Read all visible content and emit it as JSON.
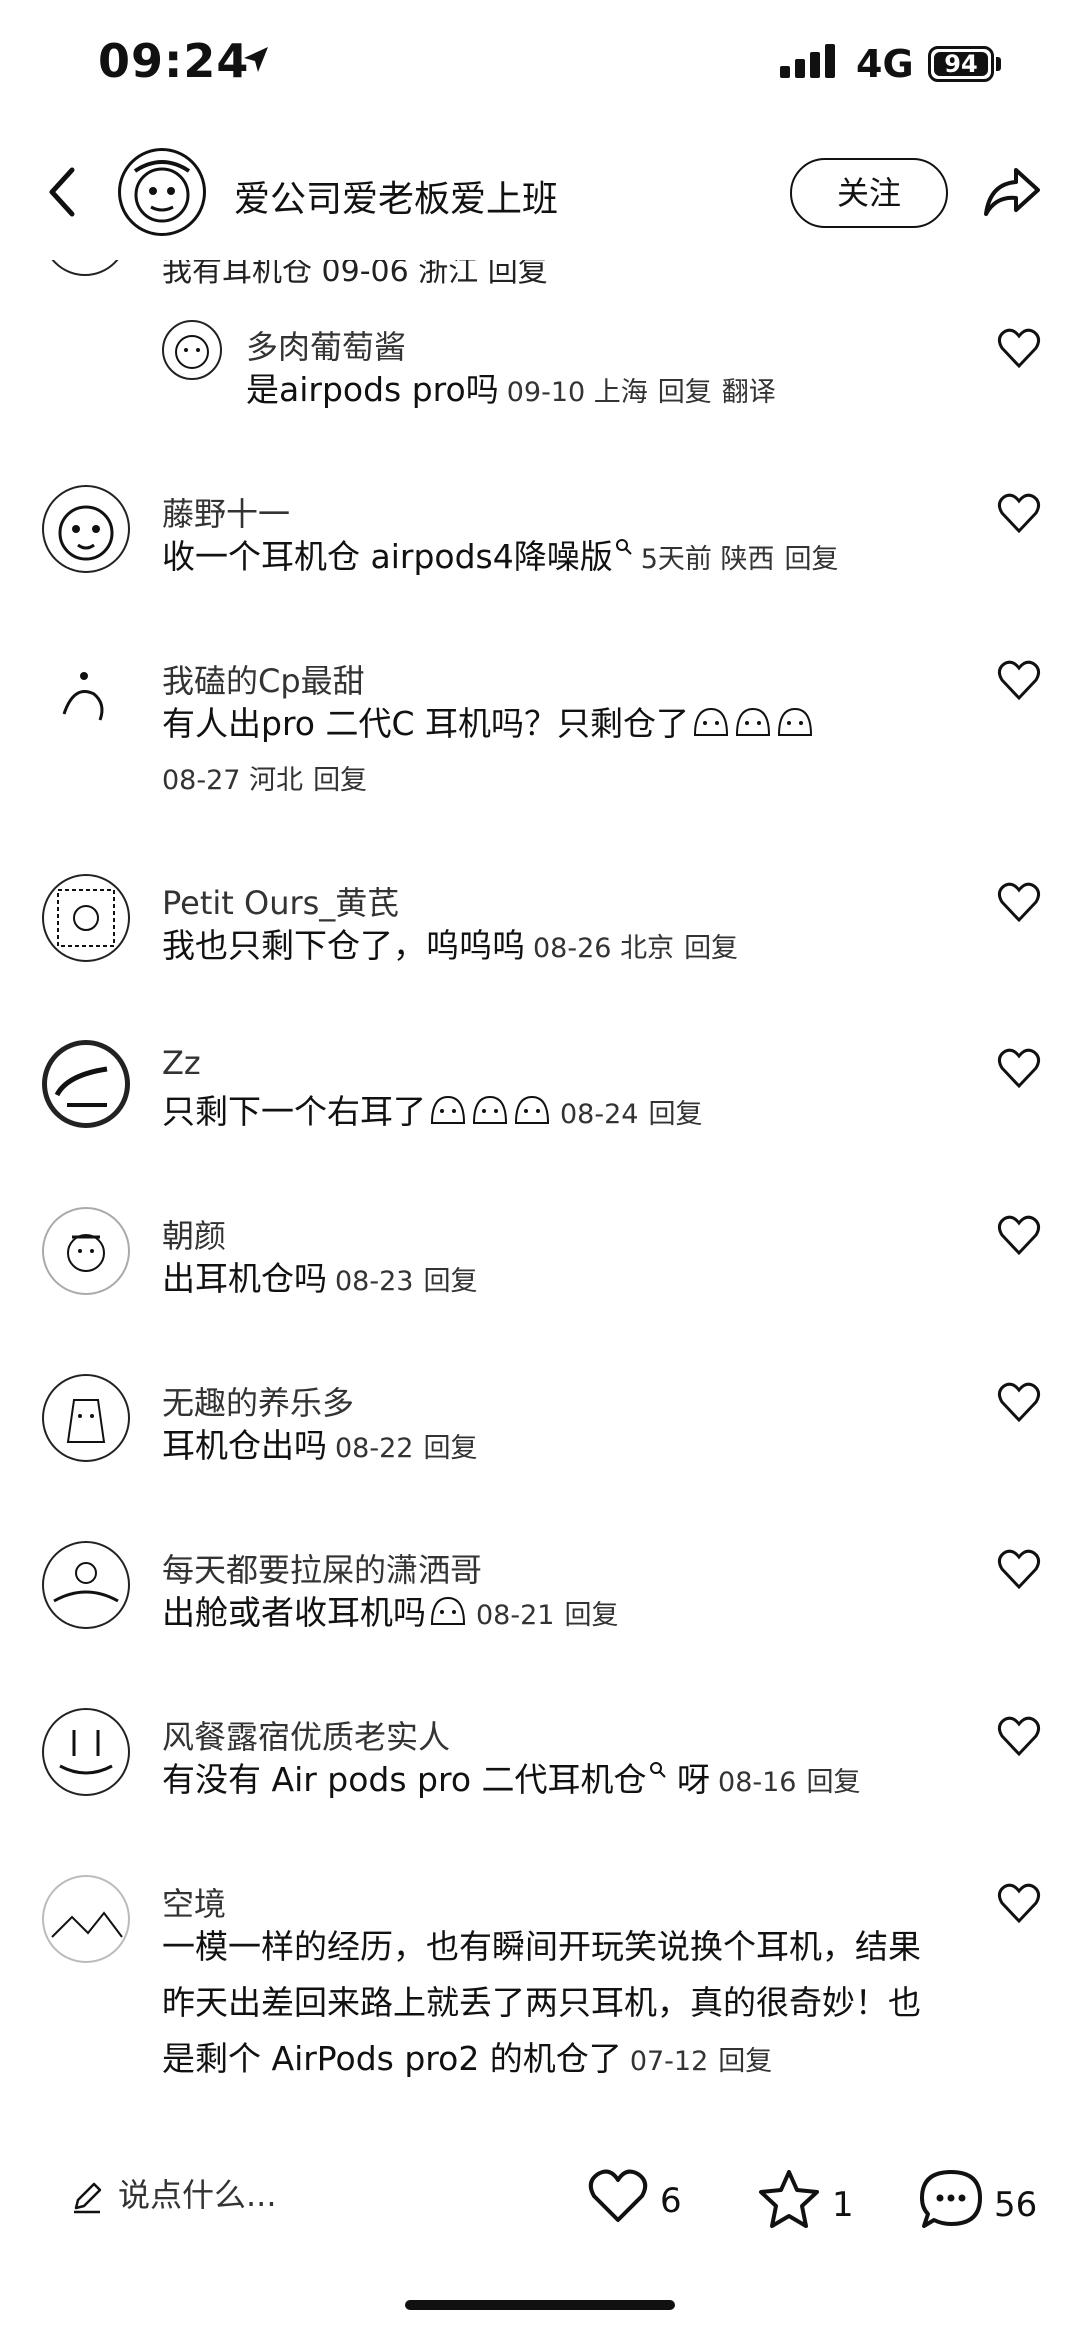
{
  "status_bar": {
    "time": "09:24",
    "network": "4G",
    "battery": "94"
  },
  "header": {
    "author": "爱公司爱老板爱上班",
    "follow_label": "关注"
  },
  "partial_comment": {
    "text": "我有耳机仓 09-06 浙江 回复"
  },
  "comments": [
    {
      "name": "多肉葡萄酱",
      "text": "是airpods pro吗",
      "time": "09-10",
      "location": "上海",
      "reply": "回复",
      "translate": "翻译"
    },
    {
      "name": "藤野十一",
      "text": "收一个耳机仓 airpods4降噪版",
      "time": "5天前",
      "location": "陕西",
      "reply": "回复"
    },
    {
      "name": "我磕的Cp最甜",
      "text": "有人出pro 二代C 耳机吗？只剩仓了",
      "time": "08-27",
      "location": "河北",
      "reply": "回复"
    },
    {
      "name": "Petit Ours_黄芪",
      "text": "我也只剩下仓了，呜呜呜",
      "time": "08-26",
      "location": "北京",
      "reply": "回复"
    },
    {
      "name": "Zz",
      "text": "只剩下一个右耳了",
      "time": "08-24",
      "reply": "回复"
    },
    {
      "name": "朝颜",
      "text": "出耳机仓吗",
      "time": "08-23",
      "reply": "回复"
    },
    {
      "name": "无趣的养乐多",
      "text": "耳机仓出吗",
      "time": "08-22",
      "reply": "回复"
    },
    {
      "name": "每天都要拉屎的潇洒哥",
      "text": "出舱或者收耳机吗",
      "time": "08-21",
      "reply": "回复"
    },
    {
      "name": "风餐露宿优质老实人",
      "text": "有没有 Air pods pro 二代耳机仓",
      "text_suffix": "呀",
      "time": "08-16",
      "reply": "回复"
    },
    {
      "name": "空境",
      "text": "一模一样的经历，也有瞬间开玩笑说换个耳机，结果昨天出差回来路上就丢了两只耳机，真的很奇妙！也是剩个 AirPods pro2 的机仓了",
      "time": "07-12",
      "reply": "回复"
    }
  ],
  "bottom_bar": {
    "input_placeholder": "说点什么...",
    "likes": "6",
    "favorites": "1",
    "comments": "56"
  }
}
